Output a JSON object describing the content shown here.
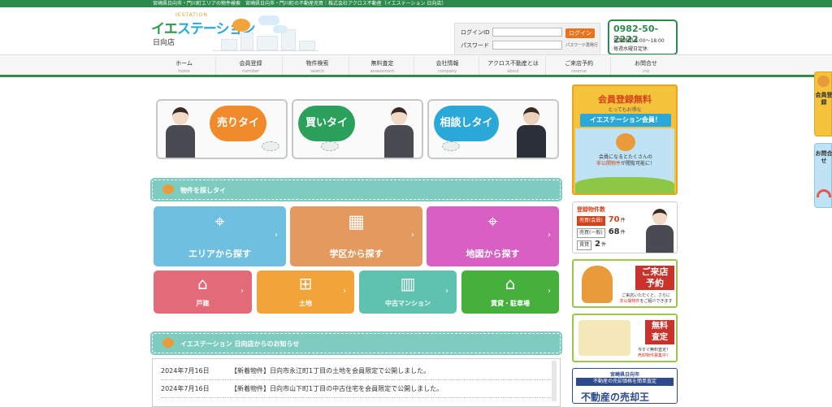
{
  "topbar": {
    "text": "宮崎県日向市・門川町エリアの物件検索　宮崎県日向市・門川町の不動産売買｜株式会社アクロス不動産（イエステーション 日向店）"
  },
  "logo": {
    "brand_a": "イエ",
    "brand_b": "ステーション",
    "ruby": "IESTATION",
    "store": "日向店",
    "icon": "fish-mascot-icon"
  },
  "login": {
    "id_label": "ログインID",
    "pw_label": "パスワード",
    "button": "ログイン",
    "reissue": "パスワード再発行"
  },
  "contact": {
    "phone": "0982-50-2222",
    "hours": "営業時間 9:00～18:00",
    "holiday": "毎週水曜日定休"
  },
  "nav": [
    {
      "jp": "ホーム",
      "en": "home"
    },
    {
      "jp": "会員登録",
      "en": "member"
    },
    {
      "jp": "物件検索",
      "en": "search"
    },
    {
      "jp": "無料査定",
      "en": "assessment"
    },
    {
      "jp": "会社情報",
      "en": "company"
    },
    {
      "jp": "アクロス不動産とは",
      "en": "about"
    },
    {
      "jp": "ご来店予約",
      "en": "reserve"
    },
    {
      "jp": "お問合せ",
      "en": "inq"
    }
  ],
  "banners": [
    {
      "label": "売りタイ",
      "color": "#f08a2a"
    },
    {
      "label": "買いタイ",
      "color": "#2aa05a"
    },
    {
      "label": "相談しタイ",
      "color": "#2aa8d8"
    }
  ],
  "search": {
    "heading": "物件を探しタイ",
    "big": [
      {
        "label": "エリアから探す",
        "icon": "map-pin-icon",
        "glyph": "⌖",
        "color": "#6fbfe0"
      },
      {
        "label": "学区から探す",
        "icon": "school-icon",
        "glyph": "▦",
        "color": "#e49a5e"
      },
      {
        "label": "地図から探す",
        "icon": "map-marker-icon",
        "glyph": "⌖",
        "color": "#d860c4"
      }
    ],
    "small": [
      {
        "label": "戸建",
        "icon": "house-icon",
        "glyph": "⌂",
        "color": "#e36a78"
      },
      {
        "label": "土地",
        "icon": "land-icon",
        "glyph": "⊞",
        "color": "#f2a33a"
      },
      {
        "label": "中古マンション",
        "icon": "building-icon",
        "glyph": "▥",
        "color": "#5fc2ae"
      },
      {
        "label": "賃貸・駐車場",
        "icon": "rental-house-icon",
        "glyph": "⌂",
        "color": "#46b03c"
      }
    ],
    "arrow": "›"
  },
  "news": {
    "heading": "イエステーション 日向店からのお知らせ",
    "items": [
      {
        "date": "2024年7月16日",
        "text": "【新着物件】日向市永江町1丁目の土地を会員限定で公開しました。"
      },
      {
        "date": "2024年7月16日",
        "text": "【新着物件】日向市山下町1丁目の中古住宅を会員限定で公開しました。"
      }
    ]
  },
  "sidebar": {
    "member": {
      "title": "会員登録無料",
      "sub": "とってもお得な",
      "banner": "イエステーション会員！",
      "msg_a": "会員になるとたくさんの",
      "msg_b": "非公開物件",
      "msg_c": "が閲覧可能に！"
    },
    "stats": {
      "heading": "登録物件数",
      "rows": [
        {
          "tag": "売買(会員)",
          "count": "70",
          "unit": "件"
        },
        {
          "tag": "売買(一般)",
          "count": "68",
          "unit": "件"
        },
        {
          "tag": "賃貸",
          "count": "2",
          "unit": "件"
        }
      ]
    },
    "visit": {
      "tag_a": "ご来店",
      "tag_b": "予約",
      "txt_a": "ご来店いただくと、さらに",
      "txt_b": "非公開物件",
      "txt_c": "をご紹介できます"
    },
    "assess": {
      "tag_a": "無料",
      "tag_b": "査定",
      "txt_a": "今すぐ無料査定！",
      "txt_b": "売却物件募集中！"
    },
    "miyazaki": {
      "t1": "宮崎県日向市",
      "t2": "不動産の売却価格を簡単査定",
      "t3": "不動産の売却王"
    }
  },
  "floating": [
    {
      "label": "会員登録",
      "color": "#f5c23c"
    },
    {
      "label": "お問合せ",
      "color": "#bfe3f4"
    }
  ]
}
